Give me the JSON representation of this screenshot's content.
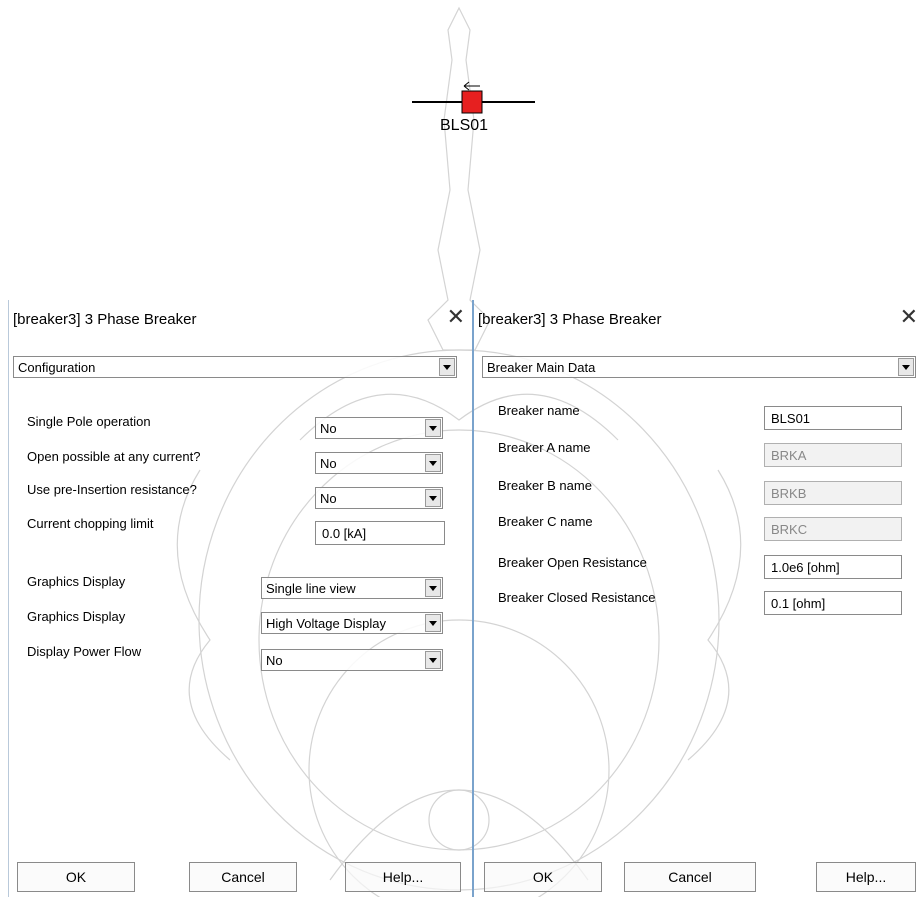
{
  "schematic": {
    "breaker_label": "BLS01"
  },
  "left_dialog": {
    "title": "[breaker3] 3 Phase Breaker",
    "section": "Configuration",
    "rows": [
      {
        "label": "Single Pole operation",
        "value": "No"
      },
      {
        "label": "Open possible at any current?",
        "value": "No"
      },
      {
        "label": "Use pre-Insertion resistance?",
        "value": "No"
      },
      {
        "label": "Current chopping limit",
        "value": "0.0 [kA]"
      },
      {
        "label": "Graphics Display",
        "value": "Single line view"
      },
      {
        "label": "Graphics Display",
        "value": "High Voltage Display"
      },
      {
        "label": "Display Power Flow",
        "value": "No"
      }
    ],
    "ok_label": "OK",
    "cancel_label": "Cancel",
    "help_label": "Help..."
  },
  "right_dialog": {
    "title": "[breaker3] 3 Phase Breaker",
    "section": "Breaker Main Data",
    "rows": [
      {
        "label": "Breaker name",
        "value": "BLS01"
      },
      {
        "label": "Breaker A name",
        "value": "BRKA"
      },
      {
        "label": "Breaker B name",
        "value": "BRKB"
      },
      {
        "label": "Breaker C name",
        "value": "BRKC"
      },
      {
        "label": "Breaker Open Resistance",
        "value": "1.0e6 [ohm]"
      },
      {
        "label": "Breaker Closed  Resistance",
        "value": "0.1 [ohm]"
      }
    ],
    "ok_label": "OK",
    "cancel_label": "Cancel",
    "help_label": "Help..."
  }
}
